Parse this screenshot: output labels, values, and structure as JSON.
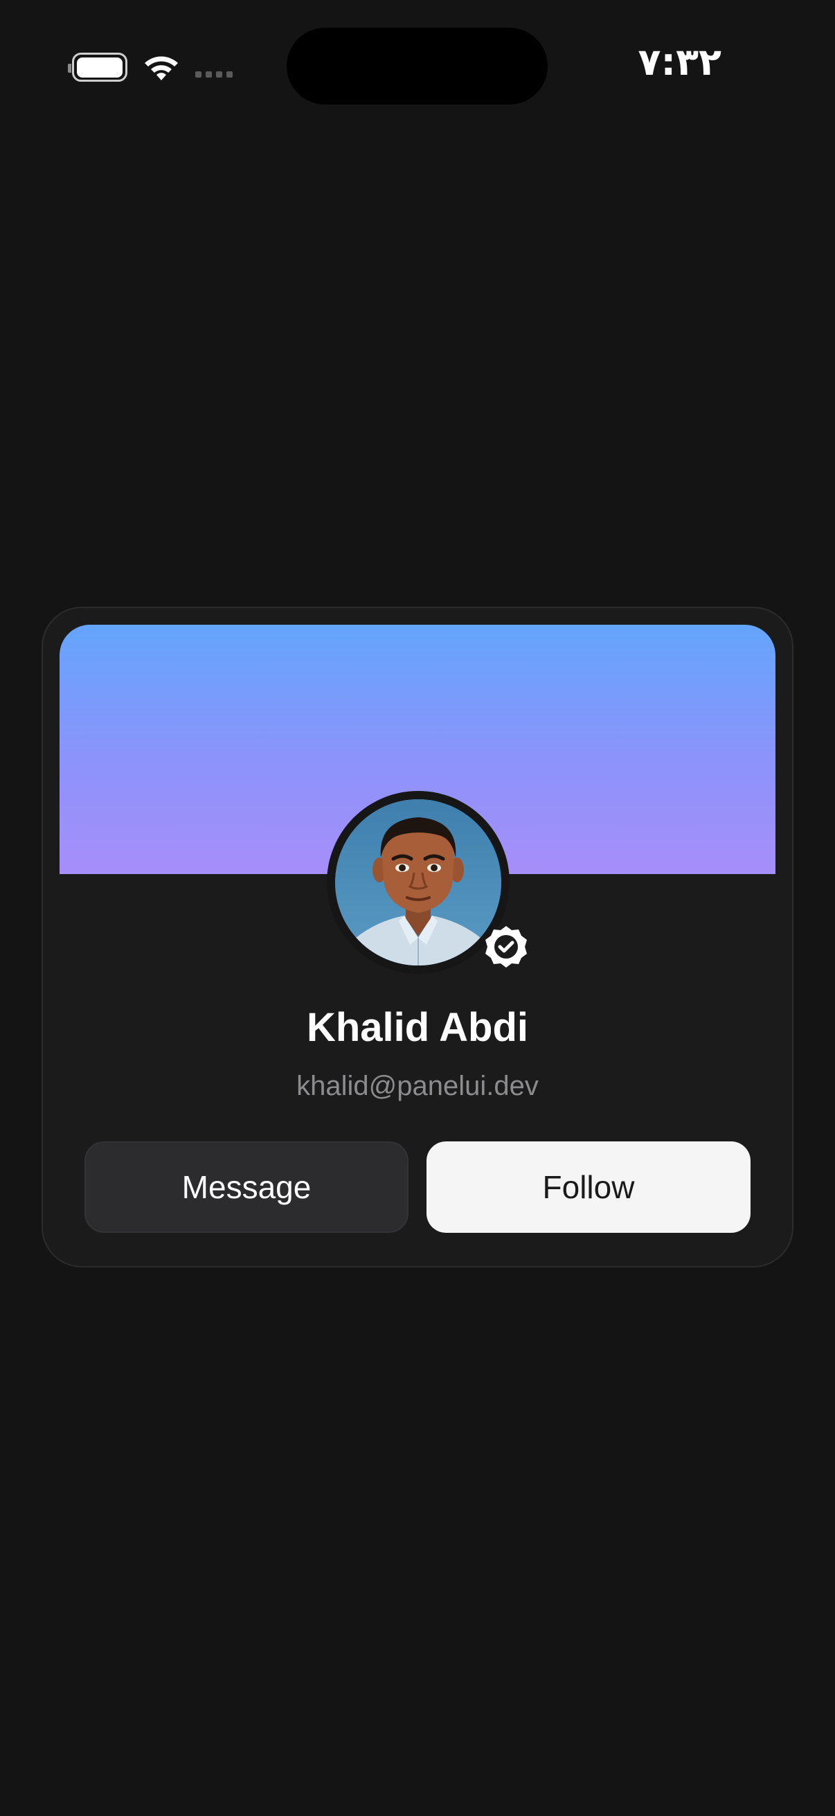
{
  "status_bar": {
    "time": "۷:۳۲",
    "battery_icon": "battery-icon",
    "wifi_icon": "wifi-icon",
    "signal_icon": "cellular-signal-icon"
  },
  "profile_card": {
    "name": "Khalid Abdi",
    "email": "khalid@panelui.dev",
    "avatar_icon": "avatar-image",
    "verified_icon": "verified-badge-icon",
    "banner_colors": [
      "#64a5fb",
      "#a78ef9"
    ],
    "buttons": {
      "message_label": "Message",
      "follow_label": "Follow"
    }
  },
  "colors": {
    "background": "#141414",
    "card": "#1b1b1c",
    "secondary_button": "#2c2c2e",
    "primary_button": "#f5f5f5",
    "muted_text": "#8c8c8e"
  }
}
